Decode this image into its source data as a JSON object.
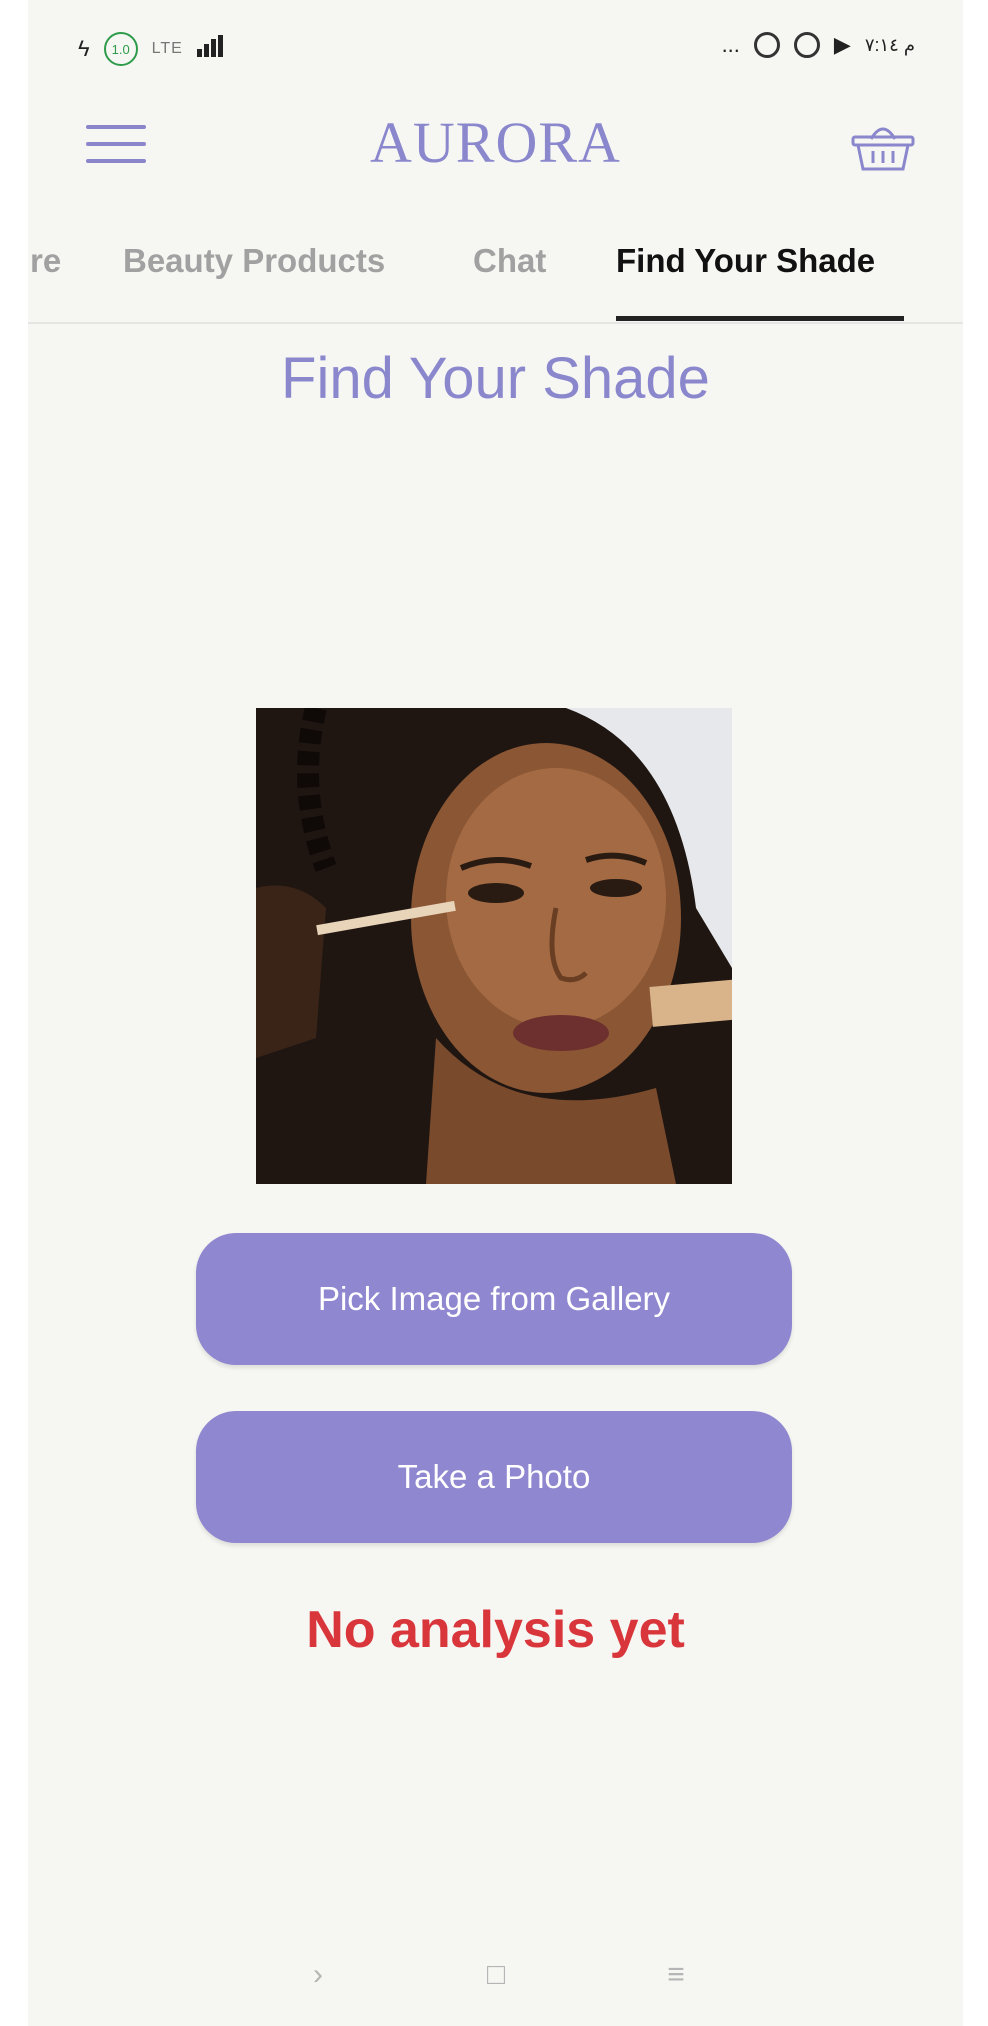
{
  "status_bar": {
    "left_badge": "1.0",
    "left_text": "LTE",
    "time": "م ٧:١٤",
    "dots": "..."
  },
  "header": {
    "brand": "AURORA",
    "menu_icon": "hamburger-menu-icon",
    "cart_icon": "basket-icon"
  },
  "tabs": [
    {
      "label": "re"
    },
    {
      "label": "Beauty Products"
    },
    {
      "label": "Chat"
    },
    {
      "label": "Find Your Shade",
      "active": true
    }
  ],
  "page": {
    "title": "Find Your Shade",
    "pick_button": "Pick Image from Gallery",
    "photo_button": "Take a Photo",
    "analysis_status": "No analysis yet"
  },
  "nav_bar": {
    "back": "›",
    "home": "□",
    "recents": "≡"
  },
  "colors": {
    "accent": "#8a87cd",
    "button": "#8f87cf",
    "error": "#d9363c",
    "background": "#f6f7f3"
  }
}
